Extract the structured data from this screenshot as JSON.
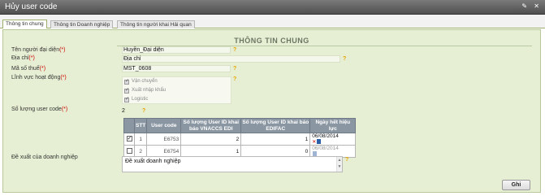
{
  "window": {
    "title": "Hủy user code",
    "controls": "✎ ✕"
  },
  "tabs": [
    {
      "label": "Thông tin chung"
    },
    {
      "label": "Thông tin Doanh nghiệp"
    },
    {
      "label": "Thông tin người khai Hải quan"
    }
  ],
  "section_title": "THÔNG TIN CHUNG",
  "fields": {
    "representative": {
      "label": "Tên người đại diện",
      "req": "(*)",
      "value": "Huyền_Đại diện"
    },
    "address": {
      "label": "Địa chỉ",
      "req": "(*)",
      "value": "Địa chỉ"
    },
    "tax_code": {
      "label": "Mã số thuế",
      "req": "(*)",
      "value": "MST_0608"
    },
    "business_field": {
      "label": "Lĩnh vực hoạt động",
      "req": "(*)",
      "options": [
        "Vận chuyển",
        "Xuất nhập khẩu",
        "Logistic"
      ]
    },
    "user_code_count": {
      "label": "Số lượng user code",
      "req": "(*)",
      "value": "2"
    },
    "proposal": {
      "label": "Đề xuất của doanh nghiệp",
      "value": "Đề xuất doanh nghiệp"
    }
  },
  "help_glyph": "?",
  "table": {
    "headers": [
      "",
      "STT",
      "User code",
      "Số lượng User ID khai báo VNACCS EDI",
      "Số lượng User ID khai báo EDIFAC",
      "Ngày hết hiệu lực"
    ],
    "rows": [
      {
        "checked": true,
        "stt": "1",
        "code": "E6753",
        "vnaccs": "2",
        "edifac": "1",
        "expiry": "06/08/2014",
        "clear": "✕"
      },
      {
        "checked": false,
        "stt": "2",
        "code": "E6754",
        "vnaccs": "1",
        "edifac": "0",
        "expiry": "06/08/2014",
        "clear": ""
      }
    ]
  },
  "buttons": {
    "send": "Ghi"
  }
}
